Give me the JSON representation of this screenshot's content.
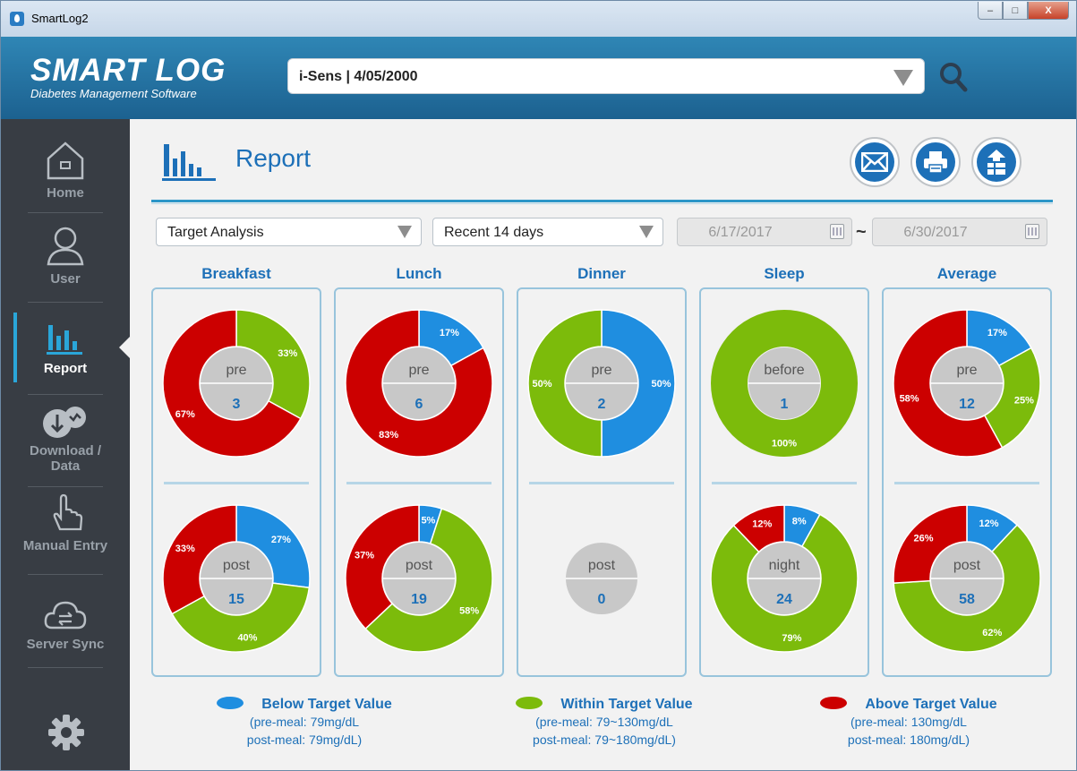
{
  "window": {
    "title": "SmartLog2",
    "min_label": "–",
    "max_label": "□",
    "close_label": "X"
  },
  "header": {
    "logo": "SMART LOG",
    "logo_sub": "Diabetes Management Software",
    "selected_device": "i-Sens | 4/05/2000"
  },
  "sidebar": {
    "items": [
      {
        "label": "Home",
        "icon": "home-icon"
      },
      {
        "label": "User",
        "icon": "user-icon"
      },
      {
        "label": "Report",
        "icon": "report-icon"
      },
      {
        "label": "Download /",
        "label2": "Data",
        "icon": "download-data-icon"
      },
      {
        "label": "Manual Entry",
        "icon": "manual-entry-icon"
      },
      {
        "label": "Server Sync",
        "icon": "cloud-sync-icon"
      }
    ],
    "active": "Report"
  },
  "page": {
    "title": "Report"
  },
  "actions": [
    "mail-icon",
    "print-icon",
    "export-icon"
  ],
  "filters": {
    "analysis": "Target Analysis",
    "period": "Recent 14 days",
    "date_from": "6/17/2017",
    "date_to": "6/30/2017",
    "separator": "~"
  },
  "colors": {
    "below": "#1f8ee0",
    "within": "#7cbb0b",
    "above": "#cc0000",
    "center": "#c8c8c8",
    "accent": "#1d70b8"
  },
  "columns": [
    {
      "name": "Breakfast",
      "top": {
        "label": "pre",
        "count": "3",
        "below": 0,
        "within": 33,
        "above": 67
      },
      "bottom": {
        "label": "post",
        "count": "15",
        "below": 27,
        "within": 40,
        "above": 33
      }
    },
    {
      "name": "Lunch",
      "top": {
        "label": "pre",
        "count": "6",
        "below": 17,
        "within": 0,
        "above": 83
      },
      "bottom": {
        "label": "post",
        "count": "19",
        "below": 5,
        "within": 58,
        "above": 37
      }
    },
    {
      "name": "Dinner",
      "top": {
        "label": "pre",
        "count": "2",
        "below": 50,
        "within": 50,
        "above": 0
      },
      "bottom": {
        "label": "post",
        "count": "0",
        "below": 0,
        "within": 0,
        "above": 0
      }
    },
    {
      "name": "Sleep",
      "top": {
        "label": "before",
        "count": "1",
        "below": 0,
        "within": 100,
        "above": 0
      },
      "bottom": {
        "label": "night",
        "count": "24",
        "below": 8,
        "within": 79,
        "above": 12
      }
    },
    {
      "name": "Average",
      "top": {
        "label": "pre",
        "count": "12",
        "below": 17,
        "within": 25,
        "above": 58
      },
      "bottom": {
        "label": "post",
        "count": "58",
        "below": 12,
        "within": 62,
        "above": 26
      }
    }
  ],
  "legend": [
    {
      "title": "Below Target Value",
      "line1": "(pre-meal: 79mg/dL",
      "line2": "post-meal: 79mg/dL)",
      "color": "#1f8ee0"
    },
    {
      "title": "Within Target Value",
      "line1": "(pre-meal: 79~130mg/dL",
      "line2": "post-meal: 79~180mg/dL)",
      "color": "#7cbb0b"
    },
    {
      "title": "Above Target Value",
      "line1": "(pre-meal: 130mg/dL",
      "line2": "post-meal: 180mg/dL)",
      "color": "#cc0000"
    }
  ]
}
